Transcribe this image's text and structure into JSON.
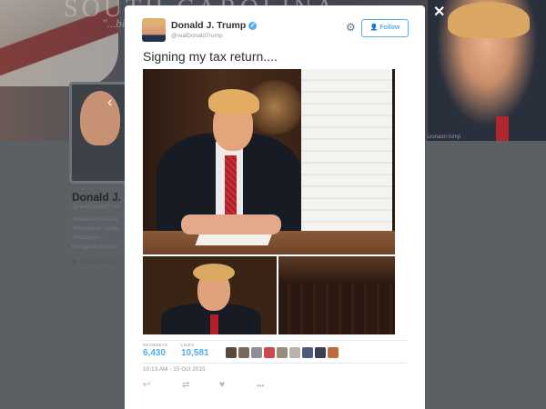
{
  "background": {
    "banner_title": "SOUTH CAROLINA",
    "banner_subtitle": "\"...big",
    "banner_letter": "I",
    "right_caption": "DonaldTrump",
    "profile": {
      "name": "Donald J. T",
      "handle": "@realDonaldTrum",
      "bio_lines": [
        "#MakeAmericaGr",
        "#Facebook: faceb",
        "#Instagram:",
        "instagram.com/re"
      ],
      "joined": "Joined March"
    }
  },
  "modal": {
    "close_glyph": "✕",
    "author": {
      "name": "Donald J. Trump",
      "verified_glyph": "✓",
      "handle": "@realDonaldTrump"
    },
    "settings_icon": "gear-icon",
    "follow_label": "Follow",
    "tweet_text": "Signing my tax return....",
    "stats": {
      "retweets_label": "RETWEETS",
      "retweets_value": "6,430",
      "likes_label": "LIKES",
      "likes_value": "10,581"
    },
    "liker_colors": [
      "#5a4a3a",
      "#7a6a5e",
      "#8a8f99",
      "#c94b4b",
      "#9a8a7a",
      "#b7b2aa",
      "#4c5a80",
      "#3a3f52",
      "#c06a3a"
    ],
    "timestamp": "10:13 AM - 15 Oct 2015",
    "actions": {
      "reply": "↩",
      "retweet": "⇄",
      "like": "♥",
      "more": "•••"
    }
  }
}
